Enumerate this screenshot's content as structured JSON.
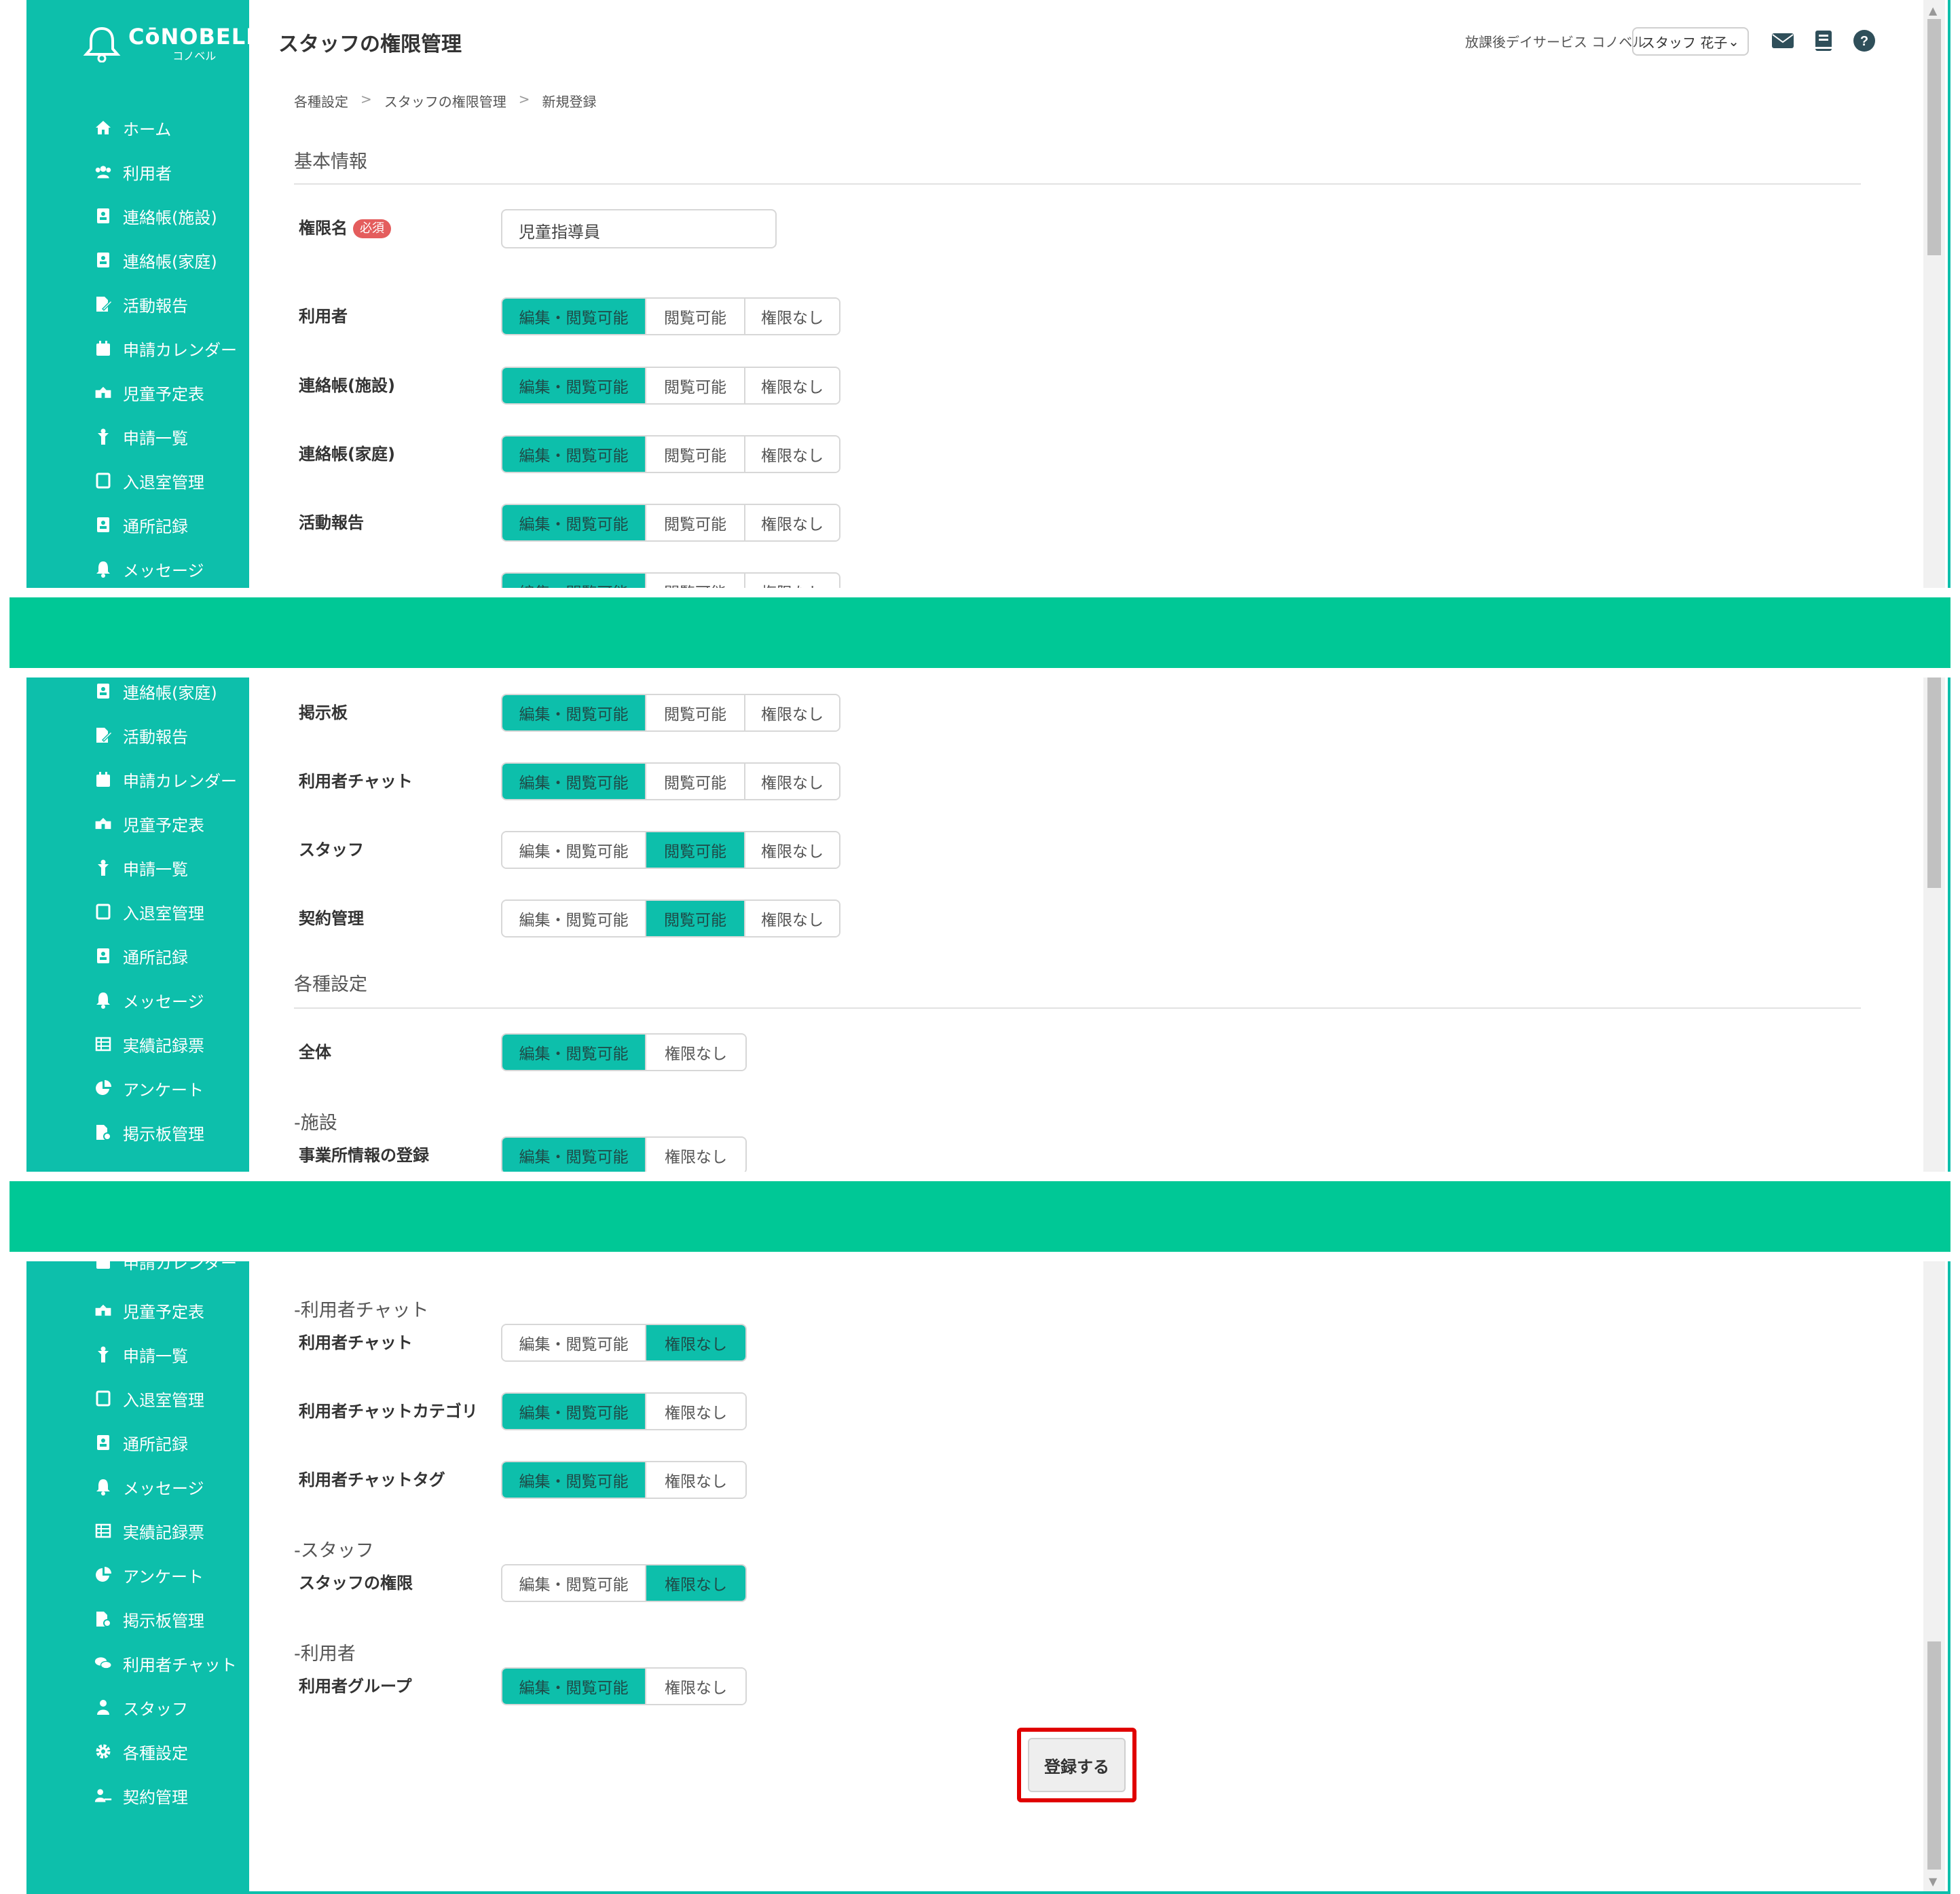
{
  "app": {
    "logo_main": "CōNOBELL",
    "logo_sub": "コノベル",
    "page_title": "スタッフの権限管理",
    "facility_name": "放課後デイサービス コノベル",
    "staff_name": "スタッフ 花子"
  },
  "colors": {
    "accent": "#0dbfab",
    "separator": "#00c896",
    "badge": "#e45d5d",
    "highlight": "#e00000"
  },
  "breadcrumb": [
    "各種設定",
    "スタッフの権限管理",
    "新規登録"
  ],
  "sidebar": {
    "home": "ホーム",
    "users": "利用者",
    "note_facility": "連絡帳(施設)",
    "note_home": "連絡帳(家庭)",
    "activity": "活動報告",
    "calendar": "申請カレンダー",
    "child_schedule": "児童予定表",
    "requests": "申請一覧",
    "entry_exit": "入退室管理",
    "attendance": "通所記録",
    "message": "メッセージ",
    "record_sheet": "実績記録票",
    "survey": "アンケート",
    "board_admin": "掲示板管理",
    "user_chat": "利用者チャット",
    "staff": "スタッフ",
    "settings": "各種設定",
    "contract": "契約管理"
  },
  "options": {
    "edit_view": "編集・閲覧可能",
    "view_only": "閲覧可能",
    "none": "権限なし"
  },
  "form": {
    "section_basic": "基本情報",
    "role_name_label": "権限名",
    "required_badge": "必須",
    "role_name_value": "児童指導員",
    "section_settings": "各種設定",
    "group_facility": "-施設",
    "group_user_chat": "-利用者チャット",
    "group_staff": "-スタッフ",
    "group_user": "-利用者",
    "submit": "登録する"
  },
  "permissions": {
    "users": "利用者",
    "note_facility": "連絡帳(施設)",
    "note_home": "連絡帳(家庭)",
    "activity": "活動報告",
    "board": "掲示板",
    "user_chat": "利用者チャット",
    "staff": "スタッフ",
    "contract": "契約管理",
    "all": "全体",
    "facility_info": "事業所情報の登録",
    "chat": "利用者チャット",
    "chat_category": "利用者チャットカテゴリ",
    "chat_tag": "利用者チャットタグ",
    "staff_perm": "スタッフの権限",
    "user_group": "利用者グループ"
  }
}
